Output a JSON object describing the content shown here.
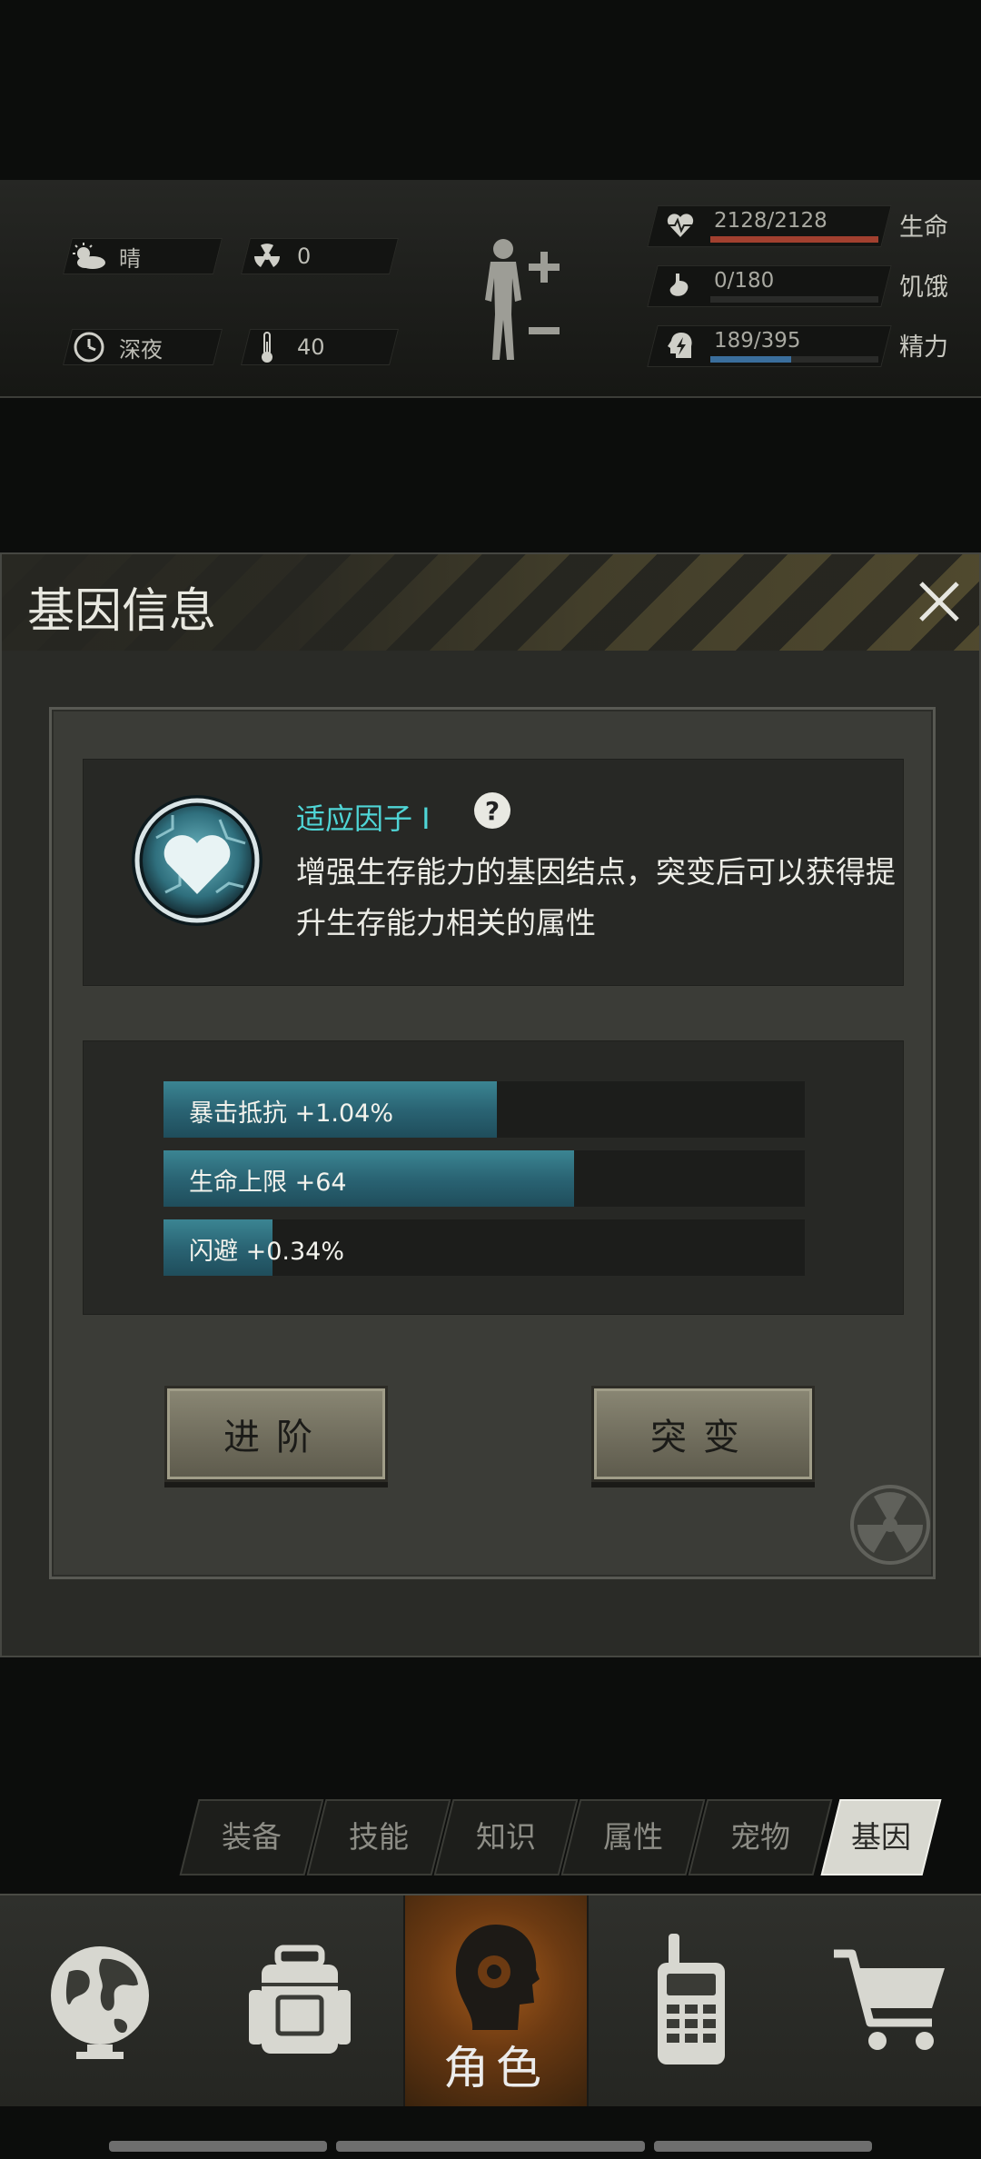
{
  "status": {
    "weather": {
      "label": "晴",
      "icon": "sun-cloud-icon"
    },
    "radiation": {
      "value": "0",
      "icon": "radiation-icon"
    },
    "time_of_day": {
      "label": "深夜",
      "icon": "clock-icon"
    },
    "temperature": {
      "value": "40",
      "icon": "thermometer-icon"
    },
    "vitals": [
      {
        "label": "生命",
        "value": "2128/2128",
        "fraction": 1.0,
        "color": "#a2402f",
        "icon": "heart-pulse-icon"
      },
      {
        "label": "饥饿",
        "value": "0/180",
        "fraction": 0.0,
        "color": "#6b6c66",
        "icon": "stomach-icon"
      },
      {
        "label": "精力",
        "value": "189/395",
        "fraction": 0.48,
        "color": "#3a6e9c",
        "icon": "energy-head-icon"
      }
    ]
  },
  "dialog": {
    "title": "基因信息",
    "gene_name": "适应因子 I",
    "gene_description": "增强生存能力的基因结点，突变后可以获得提升生存能力相关的属性",
    "stats": [
      {
        "label": "暴击抵抗 +1.04%",
        "fraction": 0.52
      },
      {
        "label": "生命上限 +64",
        "fraction": 0.64
      },
      {
        "label": "闪避 +0.34%",
        "fraction": 0.17
      }
    ],
    "advance_button": "进阶",
    "mutate_button": "突变"
  },
  "sub_tabs": [
    "装备",
    "技能",
    "知识",
    "属性",
    "宠物",
    "基因"
  ],
  "active_sub_tab": "基因",
  "bottom_nav": {
    "character_label": "角色",
    "items": [
      "globe-icon",
      "backpack-icon",
      "character-head-icon",
      "walkie-talkie-icon",
      "shopping-cart-icon"
    ]
  },
  "colors": {
    "accent_cyan": "#4fd5d6",
    "stat_bar": "#2a6474",
    "character_tab": "#a35a1b"
  }
}
